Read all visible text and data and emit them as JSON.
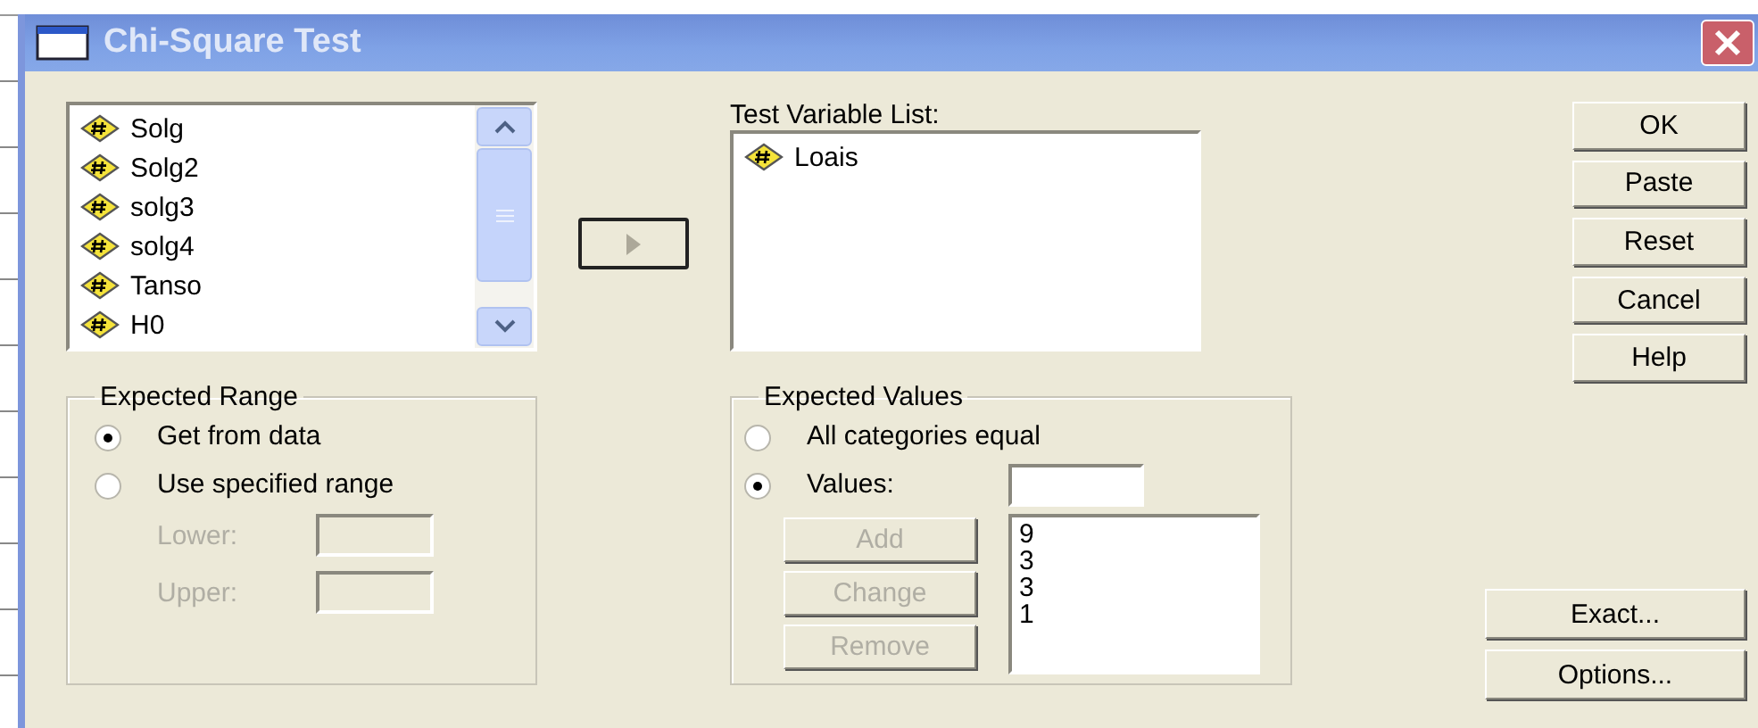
{
  "window": {
    "title": "Chi-Square Test"
  },
  "source_list": {
    "items": [
      {
        "label": "Solg"
      },
      {
        "label": "Solg2"
      },
      {
        "label": "solg3"
      },
      {
        "label": "solg4"
      },
      {
        "label": "Tanso"
      },
      {
        "label": "H0"
      }
    ]
  },
  "move_button": {
    "disabled": true
  },
  "target_list": {
    "label": "Test Variable List:",
    "items": [
      {
        "label": "Loais"
      }
    ]
  },
  "expected_range": {
    "title": "Expected Range",
    "options": [
      {
        "label": "Get from data",
        "selected": true
      },
      {
        "label": "Use specified range",
        "selected": false
      }
    ],
    "fields": [
      {
        "label": "Lower:",
        "disabled": true
      },
      {
        "label": "Upper:",
        "disabled": true
      }
    ]
  },
  "expected_values": {
    "title": "Expected Values",
    "options": [
      {
        "label": "All categories equal",
        "selected": false
      },
      {
        "label": "Values:",
        "selected": true
      }
    ],
    "buttons": [
      {
        "label": "Add",
        "disabled": true
      },
      {
        "label": "Change",
        "disabled": true
      },
      {
        "label": "Remove",
        "disabled": true
      }
    ],
    "values": [
      "9",
      "3",
      "3",
      "1"
    ]
  },
  "buttons": [
    {
      "label": "OK"
    },
    {
      "label": "Paste"
    },
    {
      "label": "Reset"
    },
    {
      "label": "Cancel"
    },
    {
      "label": "Help"
    }
  ],
  "extra_buttons": [
    {
      "label": "Exact..."
    },
    {
      "label": "Options..."
    }
  ]
}
